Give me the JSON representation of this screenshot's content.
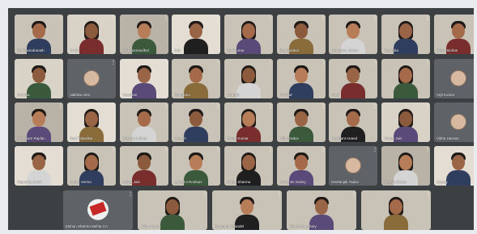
{
  "meeting": {
    "rows": [
      [
        {
          "name": "Nu Ravindranath",
          "type": "video"
        },
        {
          "name": "Dr Sit",
          "type": "video"
        },
        {
          "name": "Shubhamandhal",
          "type": "video"
        },
        {
          "name": "Priy",
          "type": "video"
        },
        {
          "name": "Ravikumar",
          "type": "video"
        },
        {
          "name": "Shubhankar",
          "type": "video"
        },
        {
          "name": "Wrajasha Jahnla",
          "type": "video"
        },
        {
          "name": "Ravindra",
          "type": "video"
        },
        {
          "name": "Shiva Mohan",
          "type": "video"
        }
      ],
      [
        {
          "name": "Shubha",
          "type": "video"
        },
        {
          "name": "Vaibhav Sen",
          "type": "avatar"
        },
        {
          "name": "Haanhan",
          "type": "video"
        },
        {
          "name": "Rangrana",
          "type": "video"
        },
        {
          "name": "Chanda",
          "type": "video"
        },
        {
          "name": "Prahlad",
          "type": "video"
        },
        {
          "name": "Vijay",
          "type": "video"
        },
        {
          "name": "",
          "type": "video"
        },
        {
          "name": "Arjit Kumar",
          "type": "avatar"
        }
      ],
      [
        {
          "name": "Shubham Rajdan",
          "type": "video"
        },
        {
          "name": "Ravi Talwalkar",
          "type": "video"
        },
        {
          "name": "Rashmi Jadhav",
          "type": "video"
        },
        {
          "name": "Yogesh",
          "type": "video"
        },
        {
          "name": "Vishal Kumar",
          "type": "video"
        },
        {
          "name": "Nidhi Yadav",
          "type": "video"
        },
        {
          "name": "Prashant Anand",
          "type": "video"
        },
        {
          "name": "Hriday Jain",
          "type": "video"
        },
        {
          "name": "Vibha Hassan",
          "type": "avatar"
        }
      ],
      [
        {
          "name": "Rajendra Joshi",
          "type": "video"
        },
        {
          "name": "Ashok Verma",
          "type": "video"
        },
        {
          "name": "Aditya Jain",
          "type": "video"
        },
        {
          "name": "Lakshmi Roshani",
          "type": "video"
        },
        {
          "name": "Vishal Sharma",
          "type": "video"
        },
        {
          "name": "Abhishek Dubey",
          "type": "video"
        },
        {
          "name": "Geetanjali Yadav",
          "type": "avatar"
        },
        {
          "name": "Shreya Gupta",
          "type": "video"
        },
        {
          "name": "Sanjay",
          "type": "video"
        }
      ],
      [
        {
          "name": "Mohan Sharma Mehta CA",
          "type": "logo"
        },
        {
          "name": "Nikita Verma",
          "type": "video"
        },
        {
          "name": "Prashant Chandel",
          "type": "video"
        },
        {
          "name": "Rohit Choudhary",
          "type": "video"
        },
        {
          "name": "",
          "type": "video"
        }
      ]
    ]
  },
  "icons": {
    "more": "more-vert-icon",
    "speaking": "mic-active-icon"
  }
}
